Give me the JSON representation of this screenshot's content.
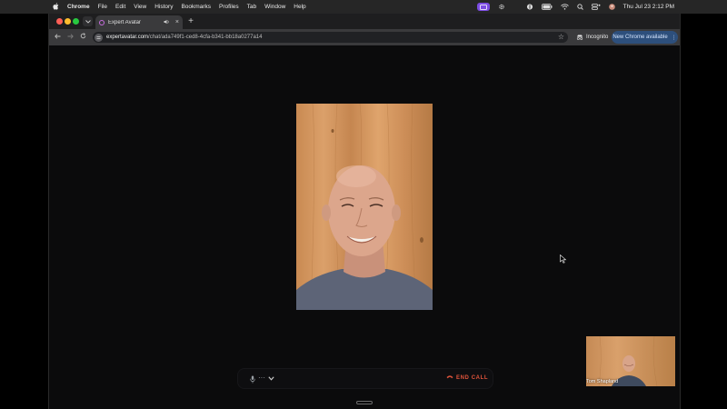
{
  "menubar": {
    "app": "Chrome",
    "items": [
      "File",
      "Edit",
      "View",
      "History",
      "Bookmarks",
      "Profiles",
      "Tab",
      "Window",
      "Help"
    ],
    "clock": "Thu Jul 23  2:12 PM"
  },
  "tab": {
    "title": "Expert Avatar",
    "audio_icon": "speaker-icon",
    "close_label": "×"
  },
  "newtab_label": "+",
  "toolbar": {
    "url_host": "expertavatar.com",
    "url_path": "/chat/ada749f1-ced8-4cfa-b341-bb18a0277a14",
    "incognito_label": "Incognito",
    "update_label": "New Chrome available"
  },
  "call": {
    "end_label": "END CALL",
    "more_label": "···"
  },
  "pip": {
    "name": "Tom Shapland"
  },
  "colors": {
    "accent": "#7b4ce2",
    "end_call": "#e2543b",
    "update_btn": "#2d4f7c"
  }
}
